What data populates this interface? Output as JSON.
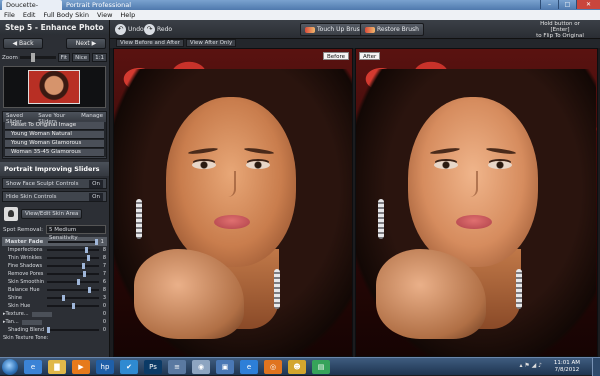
{
  "window": {
    "tab": "Doucette-44.jpg*",
    "title": "Portrait Professional",
    "controls": [
      "–",
      "□",
      "✕"
    ]
  },
  "menu": [
    "File",
    "Edit",
    "Full Body Skin",
    "View",
    "Help"
  ],
  "left": {
    "step_title": "Step 5 - Enhance Photo",
    "back_label": "◀  Back",
    "next_label": "Next  ▶",
    "zoom_label": "Zoom",
    "zoom_fit": "Fit",
    "zoom_nice": "Nice",
    "zoom_ratio": "1:1",
    "saved_sliders": {
      "label": "Saved Slider",
      "save_label": "Save Your Sliders",
      "manage_label": "Manage",
      "presets": [
        "Reset To Original Image",
        "Young Woman Natural",
        "Young Woman Glamorous",
        "Woman 35-45 Glamorous"
      ]
    },
    "improving_title": "Portrait Improving Sliders",
    "face_sculpt_label": "Show Face Sculpt Controls",
    "face_sculpt_state": "On",
    "skin_controls_label": "Hide Skin Controls",
    "skin_controls_state": "On",
    "view_skin_label": "View/Edit Skin Area",
    "spot_removal_label": "Spot Removal:",
    "spot_removal_value": "5 Medium Sensitivity",
    "master_fade": {
      "label": "Master Fade",
      "value": 100,
      "display": "1"
    },
    "sliders": [
      {
        "label": "Imperfections",
        "value": 75,
        "display": "8"
      },
      {
        "label": "Thin Wrinkles",
        "value": 78,
        "display": "8"
      },
      {
        "label": "Fine Shadows",
        "value": 70,
        "display": "7"
      },
      {
        "label": "Remove Pores",
        "value": 72,
        "display": "7"
      },
      {
        "label": "Skin Smoothing",
        "value": 60,
        "display": "6"
      },
      {
        "label": "Balance Hue",
        "value": 80,
        "display": "8"
      },
      {
        "label": "Shine",
        "value": 30,
        "display": "3"
      },
      {
        "label": "Skin Hue",
        "value": 50,
        "display": "0"
      }
    ],
    "texture_label": "Texture...",
    "texture_value": "0",
    "tan_label": "Tan...",
    "tan_value": "0",
    "shading_blend": {
      "label": "Shading Blend",
      "value": 0,
      "display": "0"
    },
    "texture_tone_label": "Skin Texture Tone:"
  },
  "toolbar": {
    "undo_label": "Undo",
    "redo_label": "Redo",
    "touchup_label": "Touch Up Brush",
    "restore_label": "Restore Brush",
    "hint_line1": "Hold button or [Enter]",
    "hint_line2": "to Flip To Original"
  },
  "viewtabs": [
    "View Before and After",
    "View After Only"
  ],
  "photos": {
    "before_tag": "Before",
    "after_tag": "After"
  },
  "taskbar": {
    "time": "11:01 AM",
    "date": "7/8/2012",
    "apps": [
      {
        "name": "ie-icon",
        "glyph": "e",
        "color": "#3b83d6"
      },
      {
        "name": "folder-icon",
        "glyph": "▇",
        "color": "#e0b84a"
      },
      {
        "name": "media-icon",
        "glyph": "▶",
        "color": "#e67a1c"
      },
      {
        "name": "hp-icon",
        "glyph": "hp",
        "color": "#1f5fa8"
      },
      {
        "name": "checkmark-icon",
        "glyph": "✔",
        "color": "#2f8ad1"
      },
      {
        "name": "photoshop-icon",
        "glyph": "Ps",
        "color": "#0b3a66"
      },
      {
        "name": "list-icon",
        "glyph": "≡",
        "color": "#5a79a1"
      },
      {
        "name": "camera-icon",
        "glyph": "◉",
        "color": "#8ea5c1"
      },
      {
        "name": "window-icon",
        "glyph": "▣",
        "color": "#4a78b5"
      },
      {
        "name": "ie2-icon",
        "glyph": "e",
        "color": "#2d7fd8"
      },
      {
        "name": "firefox-icon",
        "glyph": "◎",
        "color": "#e0741f"
      },
      {
        "name": "portrait-icon",
        "glyph": "☻",
        "color": "#d3a62e"
      },
      {
        "name": "green-app-icon",
        "glyph": "▤",
        "color": "#36a35a"
      }
    ]
  }
}
